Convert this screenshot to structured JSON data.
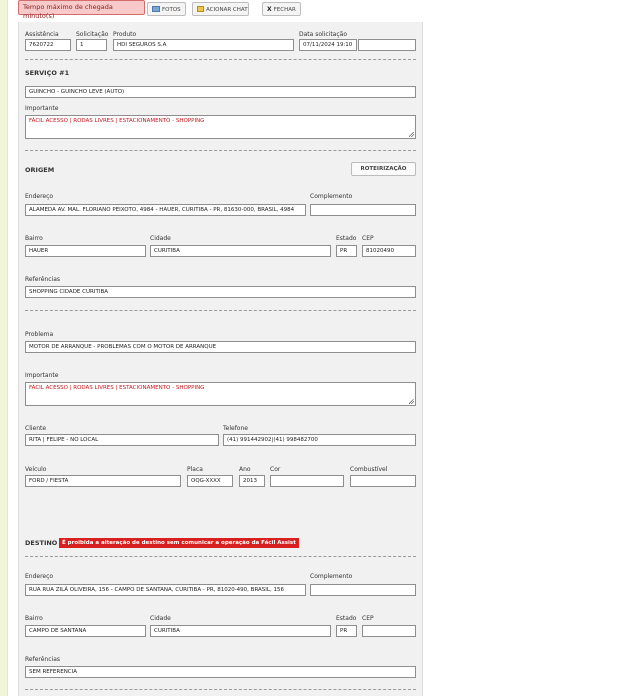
{
  "toolbar": {
    "alert": "Tempo máximo de chegada minuto(s)",
    "photos_label": "FOTOS",
    "chat_label": "ACIONAR CHAT",
    "close_icon": "X",
    "close_label": "FECHAR"
  },
  "header": {
    "assistencia_label": "Assistência",
    "assistencia_value": "7620722",
    "solicitacao_label": "Solicitação",
    "solicitacao_value": "1",
    "produto_label": "Produto",
    "produto_value": "HDI SEGUROS S.A",
    "data_label": "Data solicitação",
    "data_value": "07/11/2024 19:10",
    "extra_value": ""
  },
  "servico": {
    "title": "SERVIÇO #1",
    "service_value": "GUINCHO - GUINCHO LEVE (AUTO)",
    "importante_label": "Importante",
    "importante_value": "FÁCIL ACESSO | RODAS LIVRES | ESTACIONAMENTO - SHOPPING"
  },
  "origem": {
    "title": "ORIGEM",
    "roteirizacao_label": "ROTEIRIZAÇÃO",
    "endereco_label": "Endereço",
    "endereco_value": "ALAMEDA  AV. MAL. FLORIANO PEIXOTO, 4984 - HAUER, CURITIBA - PR, 81630-000, BRASIL, 4984",
    "complemento_label": "Complemento",
    "complemento_value": "",
    "bairro_label": "Bairro",
    "bairro_value": "HAUER",
    "cidade_label": "Cidade",
    "cidade_value": "CURITIBA",
    "estado_label": "Estado",
    "estado_value": "PR",
    "cep_label": "CEP",
    "cep_value": "81020490",
    "referencias_label": "Referências",
    "referencias_value": "SHOPPING CIDADE CURITIBA"
  },
  "problema": {
    "problema_label": "Problema",
    "problema_value": "MOTOR DE ARRANQUE - PROBLEMAS COM O MOTOR DE ARRANQUE",
    "importante_label": "Importante",
    "importante_value": "FÁCIL ACESSO | RODAS LIVRES | ESTACIONAMENTO - SHOPPING",
    "cliente_label": "Cliente",
    "cliente_value": "RITA | FELIPE - NO LOCAL",
    "telefone_label": "Telefone",
    "telefone_value": "(41) 991442902|(41) 998482700",
    "veiculo_label": "Veículo",
    "veiculo_value": "FORD / FIESTA",
    "placa_label": "Placa",
    "placa_value": "OQG-XXXX",
    "ano_label": "Ano",
    "ano_value": "2013",
    "cor_label": "Cor",
    "cor_value": "",
    "combustivel_label": "Combustível",
    "combustivel_value": ""
  },
  "destino": {
    "title": "DESTINO",
    "warning": "É proibida a alteração de destino sem comunicar a operação da Fácil Assist",
    "endereco_label": "Endereço",
    "endereco_value": "RUA RUA ZILÁ OLIVEIRA, 156 - CAMPO DE SANTANA, CURITIBA - PR, 81020-490, BRASIL, 156",
    "complemento_label": "Complemento",
    "complemento_value": "",
    "bairro_label": "Bairro",
    "bairro_value": "CAMPO DE SANTANA",
    "cidade_label": "Cidade",
    "cidade_value": "CURITIBA",
    "estado_label": "Estado",
    "estado_value": "PR",
    "cep_label": "CEP",
    "cep_value": "",
    "referencias_label": "Referências",
    "referencias_value": "SEM REFERENCIA"
  }
}
